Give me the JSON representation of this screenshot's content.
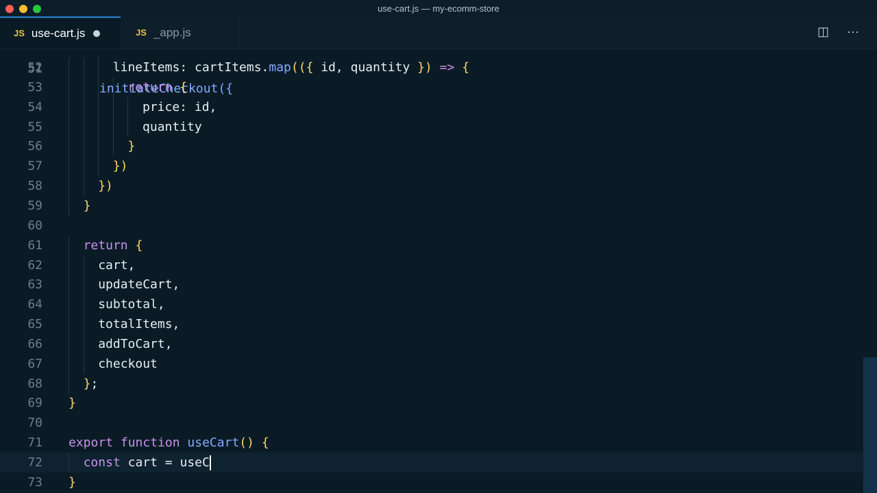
{
  "window": {
    "title": "use-cart.js — my-ecomm-store"
  },
  "traffic_colors": {
    "close": "#fe5f57",
    "minimize": "#febc2e",
    "zoom": "#28c840"
  },
  "tabs": [
    {
      "badge": "JS",
      "label": "use-cart.js",
      "active": true,
      "modified": true
    },
    {
      "badge": "JS",
      "label": "_app.js",
      "active": false,
      "modified": false
    }
  ],
  "actions": {
    "split_icon": "split-editor-icon",
    "more_icon": "more-actions-icon",
    "split_glyph": "◫",
    "more_glyph": "···"
  },
  "editor": {
    "partial_top_line": {
      "number": "51",
      "text": "initiateCheckout({"
    },
    "lines": [
      {
        "n": "52",
        "text": "lineItems: cartItems.map(({ id, quantity }) => {"
      },
      {
        "n": "53",
        "text": "return {"
      },
      {
        "n": "54",
        "text": "price: id,"
      },
      {
        "n": "55",
        "text": "quantity"
      },
      {
        "n": "56",
        "text": "}"
      },
      {
        "n": "57",
        "text": "})"
      },
      {
        "n": "58",
        "text": "})"
      },
      {
        "n": "59",
        "text": "}"
      },
      {
        "n": "60",
        "text": ""
      },
      {
        "n": "61",
        "text": "return {"
      },
      {
        "n": "62",
        "text": "cart,"
      },
      {
        "n": "63",
        "text": "updateCart,"
      },
      {
        "n": "64",
        "text": "subtotal,"
      },
      {
        "n": "65",
        "text": "totalItems,"
      },
      {
        "n": "66",
        "text": "addToCart,"
      },
      {
        "n": "67",
        "text": "checkout"
      },
      {
        "n": "68",
        "text": "};"
      },
      {
        "n": "69",
        "text": "}"
      },
      {
        "n": "70",
        "text": ""
      },
      {
        "n": "71",
        "text": "export function useCart() {"
      },
      {
        "n": "72",
        "text": "const cart = useC"
      },
      {
        "n": "73",
        "text": "}"
      }
    ]
  }
}
